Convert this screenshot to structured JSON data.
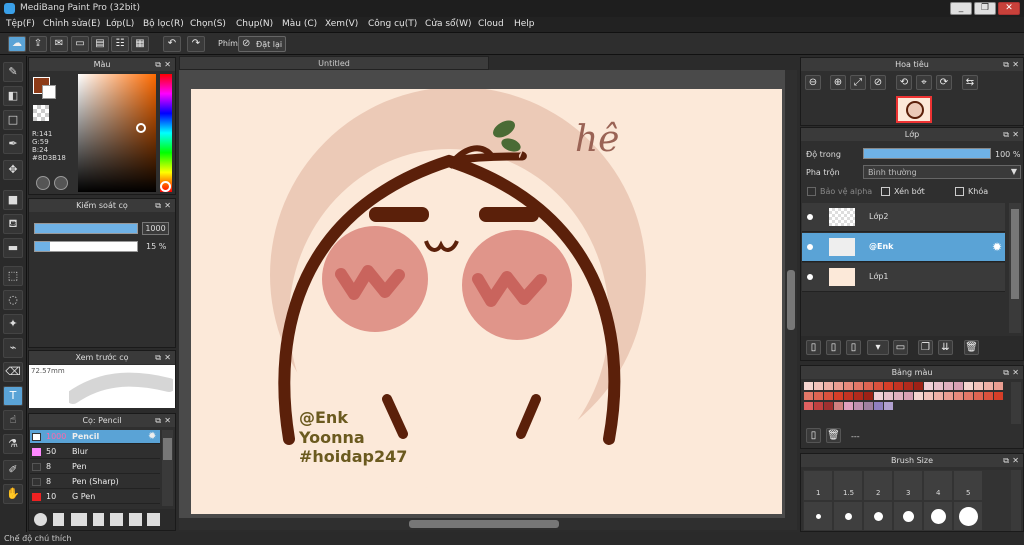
{
  "app": {
    "title": "MediBang Paint Pro (32bit)"
  },
  "menu": [
    "Tệp(F)",
    "Chỉnh sửa(E)",
    "Lớp(L)",
    "Bộ lọc(R)",
    "Chọn(S)",
    "Chụp(N)",
    "Màu (C)",
    "Xem(V)",
    "Công cụ(T)",
    "Cửa sổ(W)",
    "Cloud",
    "Help"
  ],
  "toolbar": {
    "shortcut_label": "Phím",
    "reset_label": "Đặt lại"
  },
  "color_panel": {
    "title": "Màu",
    "r": "R:141",
    "g": "G:59",
    "b": "B:24",
    "hex": "#8D3B18",
    "primary_color": "#8D3B18"
  },
  "brush_control": {
    "title": "Kiểm soát cọ",
    "size": "1000",
    "opacity": "15 %",
    "opacity_fraction": 0.15
  },
  "brush_preview": {
    "title": "Xem trước cọ",
    "size_label": "72.57mm"
  },
  "brush_list": {
    "title": "Cọ: Pencil",
    "items": [
      {
        "size": "1000",
        "name": "Pencil",
        "color": "#ffffff"
      },
      {
        "size": "50",
        "name": "Blur",
        "color": "#ff88ff"
      },
      {
        "size": "8",
        "name": "Pen",
        "color": "#333333"
      },
      {
        "size": "8",
        "name": "Pen (Sharp)",
        "color": "#333333"
      },
      {
        "size": "10",
        "name": "G Pen",
        "color": "#ee2222"
      }
    ]
  },
  "document": {
    "tab": "Untitled"
  },
  "artwork": {
    "signature_1": "@Enk",
    "signature_2": "Yoonna",
    "signature_3": "#hoidap247",
    "mark": "hê"
  },
  "navigator": {
    "title": "Hoa tiêu"
  },
  "layers": {
    "title": "Lớp",
    "opacity_label": "Độ trong",
    "opacity_value": "100 %",
    "opacity_fraction": 1.0,
    "blend_label": "Pha trộn",
    "blend_value": "Bình thường",
    "protect_alpha": "Bảo vệ alpha",
    "clipping": "Xén bớt",
    "lock": "Khóa",
    "items": [
      {
        "name": "Lớp2"
      },
      {
        "name": "@Enk"
      },
      {
        "name": "Lớp1"
      }
    ]
  },
  "palette": {
    "title": "Bảng màu",
    "dash": "---"
  },
  "brush_size": {
    "title": "Brush Size",
    "labels": [
      "1",
      "1.5",
      "2",
      "3",
      "4",
      "5"
    ]
  },
  "status": {
    "text": "Chế độ chú thích"
  }
}
